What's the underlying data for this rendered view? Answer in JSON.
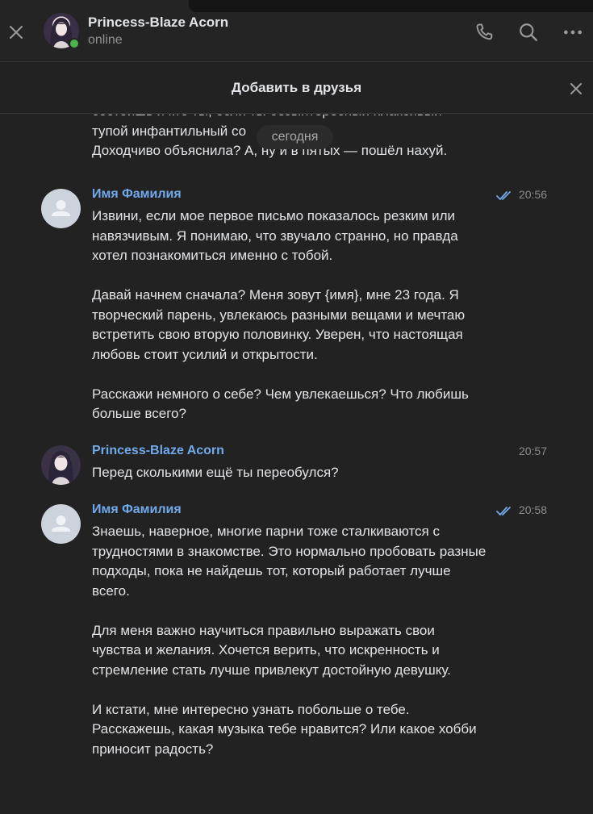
{
  "header": {
    "peer_name": "Princess-Blaze Acorn",
    "peer_status": "online",
    "online_color": "#4bb34b"
  },
  "friend_bar": {
    "label": "Добавить в друзья"
  },
  "date_divider": "сегодня",
  "previous_message": {
    "lines": [
      "состоишь и кто ты, если ты безынтересный плаксивый",
      "тупой инфантильный со",
      "Доходчиво объяснила? А, ну и в пятых — пошёл нахуй."
    ]
  },
  "messages": [
    {
      "author": "Имя Фамилия",
      "time": "20:56",
      "read": true,
      "avatar": "default-avatar",
      "paragraphs": [
        "Извини, если мое первое письмо показалось резким или навязчивым. Я понимаю, что звучало странно, но правда хотел познакомиться именно с тобой.",
        "Давай начнем сначала? Меня зовут {имя}, мне 23 года. Я творческий парень, увлекаюсь разными вещами и мечтаю встретить свою вторую половинку. Уверен, что настоящая любовь стоит усилий и открытости.",
        "Расскажи немного о себе? Чем увлекаешься? Что любишь больше всего?"
      ]
    },
    {
      "author": "Princess-Blaze Acorn",
      "time": "20:57",
      "read": false,
      "avatar": "anime-girl-avatar",
      "paragraphs": [
        "Перед сколькими ещё ты переобулся?"
      ]
    },
    {
      "author": "Имя Фамилия",
      "time": "20:58",
      "read": true,
      "avatar": "default-avatar",
      "paragraphs": [
        "Знаешь, наверное, многие парни тоже сталкиваются с трудностями в знакомстве. Это нормально пробовать разные подходы, пока не найдешь тот, который работает лучше всего.",
        "Для меня важно научиться правильно выражать свои чувства и желания. Хочется верить, что искренность и стремление стать лучше привлекут достойную девушку.",
        "И кстати, мне интересно узнать побольше о тебе. Расскажешь, какая музыка тебе нравится? Или какое хобби приносит радость?"
      ]
    }
  ],
  "colors": {
    "background": "#222222",
    "author_link": "#71aaeb",
    "text": "#e1e3e6",
    "muted": "#939393"
  },
  "icons": {
    "close": "close-icon",
    "phone": "phone-icon",
    "search": "search-icon",
    "more": "more-icon",
    "read_ticks": "double-check-icon"
  }
}
